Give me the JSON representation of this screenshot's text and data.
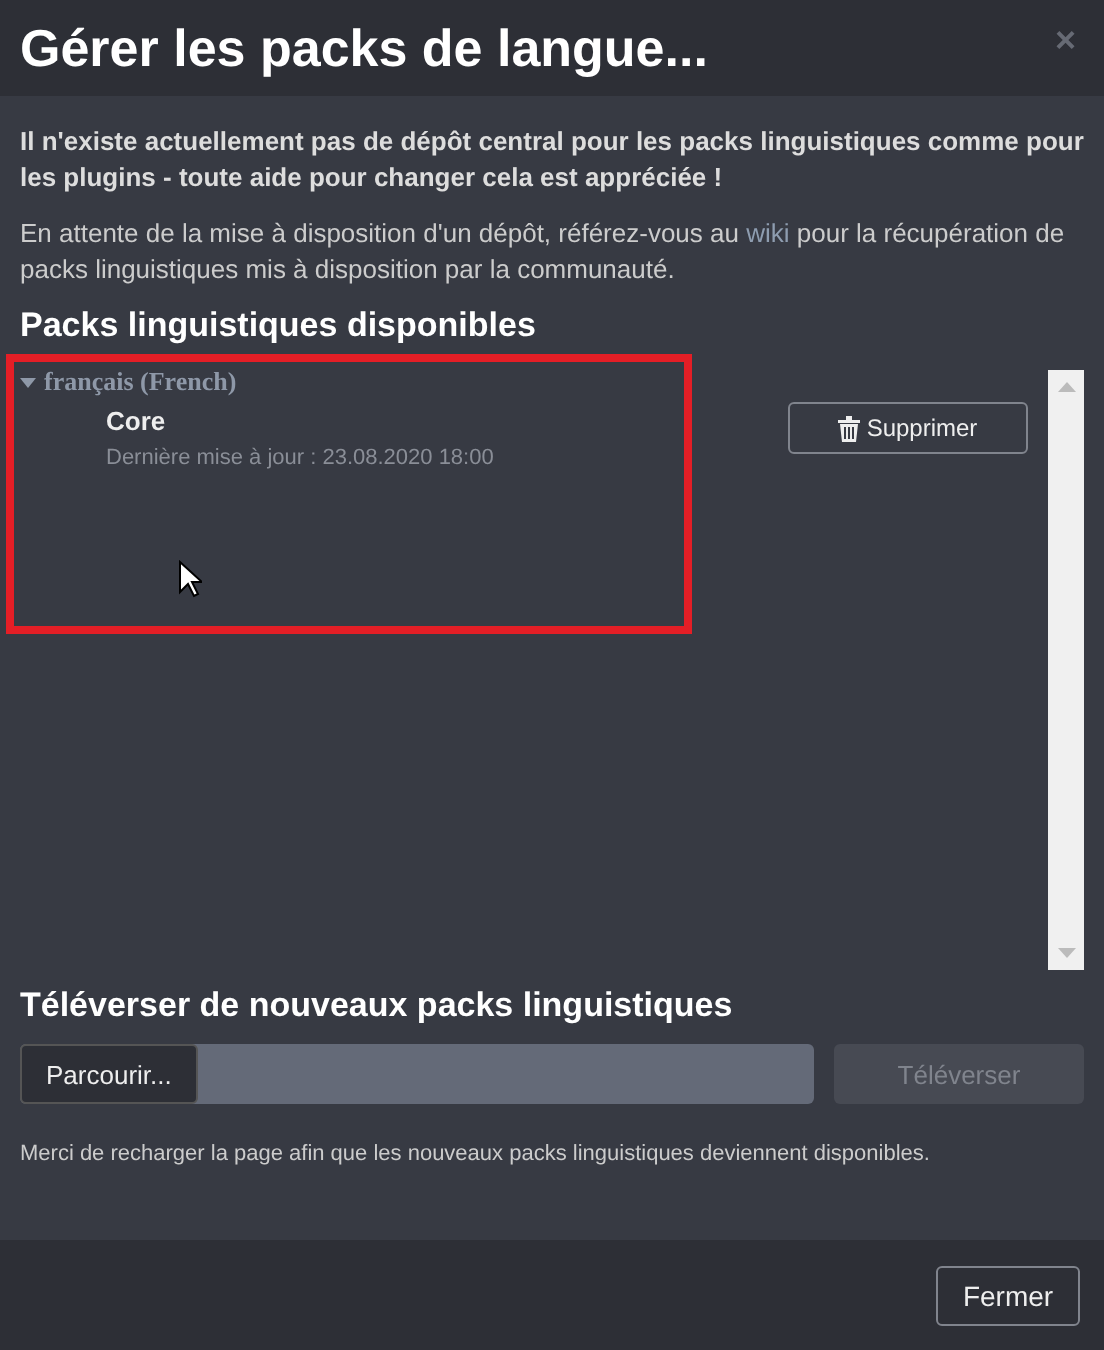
{
  "dialog": {
    "title": "Gérer les packs de langue...",
    "close": "×"
  },
  "notice": "Il n'existe actuellement pas de dépôt central pour les packs linguistiques comme pour les plugins - toute aide pour changer cela est appréciée !",
  "info": {
    "before": "En attente de la mise à disposition d'un dépôt, référez-vous au",
    "link": "wiki",
    "after": "pour la récupération de packs linguistiques mis à disposition par la communauté."
  },
  "available": {
    "heading": "Packs linguistiques disponibles",
    "languages": [
      {
        "name": "français (French)",
        "expanded": true,
        "packs": [
          {
            "name": "Core",
            "updated": "Dernière mise à jour : 23.08.2020 18:00",
            "action": "Supprimer"
          }
        ]
      }
    ]
  },
  "upload": {
    "heading": "Téléverser de nouveaux packs linguistiques",
    "browse": "Parcourir...",
    "submit": {
      "label": "Téléverser",
      "disabled": true
    },
    "hint": "Merci de recharger la page afin que les nouveaux packs linguistiques deviennent disponibles."
  },
  "footer": {
    "buttons": [
      "Fermer"
    ]
  }
}
